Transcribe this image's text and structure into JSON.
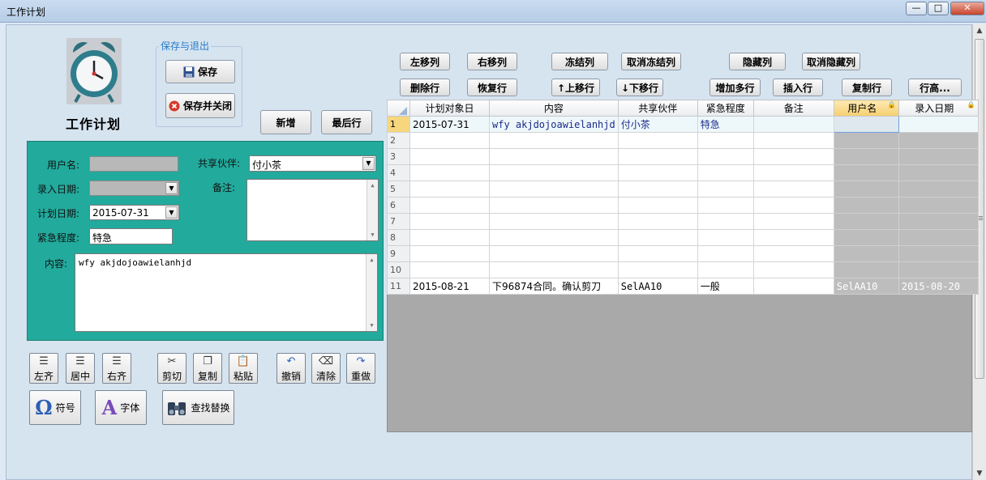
{
  "window": {
    "title": "工作计划",
    "min": "—",
    "max": "□",
    "close": "✕"
  },
  "app": {
    "title": "工作计划"
  },
  "save_group": {
    "label": "保存与退出",
    "save": "保存",
    "save_close": "保存并关闭"
  },
  "actions": {
    "new": "新增",
    "last_row": "最后行"
  },
  "form": {
    "username_label": "用户名:",
    "username": "",
    "entry_date_label": "录入日期:",
    "entry_date": "",
    "plan_date_label": "计划日期:",
    "plan_date": "2015-07-31",
    "urgency_label": "紧急程度:",
    "urgency": "特急",
    "partner_label": "共享伙伴:",
    "partner": "付小茶",
    "notes_label": "备注:",
    "notes": "",
    "content_label": "内容:",
    "content": "wfy akjdojoawielanhjd"
  },
  "edit_toolbar": {
    "align_left": "左齐",
    "align_center": "居中",
    "align_right": "右齐",
    "cut": "剪切",
    "copy": "复制",
    "paste": "粘贴",
    "undo": "撤销",
    "clear": "清除",
    "redo": "重做",
    "symbol": "符号",
    "font": "字体",
    "find_replace": "查找替换",
    "symbol_glyph": "Ω",
    "font_glyph": "A"
  },
  "grid_toolbar": {
    "move_left": "左移列",
    "move_right": "右移列",
    "freeze": "冻结列",
    "unfreeze": "取消冻结列",
    "hide_col": "隐藏列",
    "unhide_col": "取消隐藏列",
    "delete_row": "删除行",
    "restore_row": "恢复行",
    "move_up": "↑上移行",
    "move_down": "↓下移行",
    "add_rows": "增加多行",
    "insert_row": "插入行",
    "copy_row": "复制行",
    "row_height": "行高..."
  },
  "grid": {
    "columns": [
      "计划对象日",
      "内容",
      "共享伙伴",
      "紧急程度",
      "备注",
      "用户名",
      "录入日期"
    ],
    "rows": [
      {
        "n": "1",
        "date": "2015-07-31",
        "content": "wfy akjdojoawielanhjd",
        "partner": "付小茶",
        "urgency": "特急",
        "note": "",
        "user": "",
        "entry": ""
      },
      {
        "n": "2",
        "date": "",
        "content": "",
        "partner": "",
        "urgency": "",
        "note": "",
        "user": "",
        "entry": ""
      },
      {
        "n": "3",
        "date": "",
        "content": "",
        "partner": "",
        "urgency": "",
        "note": "",
        "user": "",
        "entry": ""
      },
      {
        "n": "4",
        "date": "",
        "content": "",
        "partner": "",
        "urgency": "",
        "note": "",
        "user": "",
        "entry": ""
      },
      {
        "n": "5",
        "date": "",
        "content": "",
        "partner": "",
        "urgency": "",
        "note": "",
        "user": "",
        "entry": ""
      },
      {
        "n": "6",
        "date": "",
        "content": "",
        "partner": "",
        "urgency": "",
        "note": "",
        "user": "",
        "entry": ""
      },
      {
        "n": "7",
        "date": "",
        "content": "",
        "partner": "",
        "urgency": "",
        "note": "",
        "user": "",
        "entry": ""
      },
      {
        "n": "8",
        "date": "",
        "content": "",
        "partner": "",
        "urgency": "",
        "note": "",
        "user": "",
        "entry": ""
      },
      {
        "n": "9",
        "date": "",
        "content": "",
        "partner": "",
        "urgency": "",
        "note": "",
        "user": "",
        "entry": ""
      },
      {
        "n": "10",
        "date": "",
        "content": "",
        "partner": "",
        "urgency": "",
        "note": "",
        "user": "",
        "entry": ""
      },
      {
        "n": "11",
        "date": "2015-08-21",
        "content": "下96874合同。确认剪刀",
        "partner": "SelAA10",
        "urgency": "一般",
        "note": "",
        "user": "SelAA10",
        "entry": "2015-08-20"
      }
    ]
  },
  "colors": {
    "panel": "#22aa9c",
    "client_bg": "#d6e4f0",
    "header_highlight": "#f6cf6e"
  }
}
